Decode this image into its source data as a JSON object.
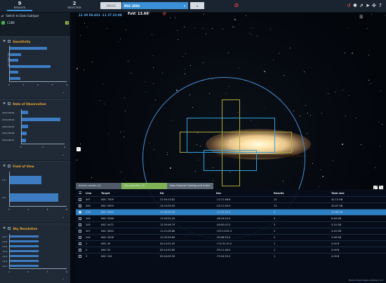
{
  "header": {
    "results_count": "9",
    "results_label": "RESULTS",
    "selected_count": "2",
    "selected_label": "SELECTED",
    "survey_combo": "2MASS",
    "search_value": "NGC 4594",
    "coordinates": "12 39 59.431 -11 37 22.98",
    "fov_label": "FoV: 13.66'"
  },
  "sidebar": {
    "switch_label": "Switch to Data Subtype",
    "cube_label": "CUBE",
    "cube_count": "9"
  },
  "panels": {
    "sensitivity": {
      "title": "Sensitivity",
      "ylabel": "Arc Index (%)",
      "bars": [
        0.65,
        0.2,
        0.15,
        0.72,
        0.15,
        0.18
      ],
      "xticks": [
        "0",
        "1",
        "2",
        "3",
        "4"
      ]
    },
    "date": {
      "title": "Date of Observation",
      "dates": [
        "2014-08-09",
        "2014-08-24",
        "2014-08-25",
        "2014-08-26",
        "2014-08-27"
      ],
      "bars": [
        0.15,
        0.9,
        0.15,
        0.12,
        0.1
      ],
      "xticks": [
        "0",
        "2",
        "4"
      ]
    },
    "fov": {
      "title": "Field of View",
      "yticks": [
        "0.1°",
        "1.0'"
      ],
      "bars": [
        0.55,
        0.85
      ],
      "xticks": [
        "0",
        "2",
        "4",
        "6"
      ]
    },
    "res": {
      "title": "Sky Resolution",
      "yticks": [
        "<0.7",
        "<0.6",
        "<0.5",
        "<0.4",
        "<0.3",
        "<0.2",
        "<0.1"
      ],
      "bars": [
        0.5,
        0.5,
        0.5,
        0.5,
        0.5,
        0.5,
        0.5
      ],
      "xticks": [
        "1",
        "2",
        "3",
        "4"
      ]
    }
  },
  "tabs": [
    {
      "label": "Search results (2)"
    },
    {
      "label": "Sky selection (2)"
    },
    {
      "label": "New General Catalog and Index"
    }
  ],
  "table": {
    "headers": [
      "",
      "Line",
      "Target",
      "RA",
      "Dec",
      "Results",
      "Total size"
    ],
    "rows": [
      [
        "497",
        "NGC 7009",
        "21:04:10.81",
        "-11:21:48.6",
        "12",
        "42.13 GB"
      ],
      [
        "240",
        "NGC 5903",
        "15:10:05.53",
        "-24:11:09.0",
        "12",
        "20.87 GB"
      ],
      [
        "246",
        "NGC 4594",
        "12:39:59.43",
        "-11:37:22.0",
        "4",
        "10.86 GB"
      ],
      [
        "244",
        "NGC 5266",
        "13:43:02.10",
        "-48:10:10.0",
        "3",
        "6.48 GB"
      ],
      [
        "245",
        "NGC 4472",
        "12:29:46.79",
        "-08:00:02.5",
        "3",
        "5.20 GB"
      ],
      [
        "207",
        "NGC 3640",
        "11:21:06.86",
        "+03:14:05.4",
        "2",
        "4.45 GB"
      ],
      [
        "244",
        "NGC 4508",
        "12:32:59.60",
        "-39:58:53.0",
        "2",
        "3.48 GB"
      ],
      [
        "1",
        "NGC 40",
        "00:13:01.05",
        "+72:31:19.0",
        "1",
        "0.00 B"
      ],
      [
        "2",
        "NGC 55",
        "00:14:53.60",
        "-39:11:48.0",
        "1",
        "0.00 B"
      ],
      [
        "3",
        "NGC 104",
        "00:24:05.35",
        "-72:04:53.2",
        "1",
        "0.00 B"
      ]
    ],
    "selected_index": 2
  },
  "footer": "ESO Archive Science Portal 1.1.0",
  "colors": {
    "accent": "#2d7fc4",
    "panel_title": "#f0a830",
    "fov": "#a8a83a"
  }
}
